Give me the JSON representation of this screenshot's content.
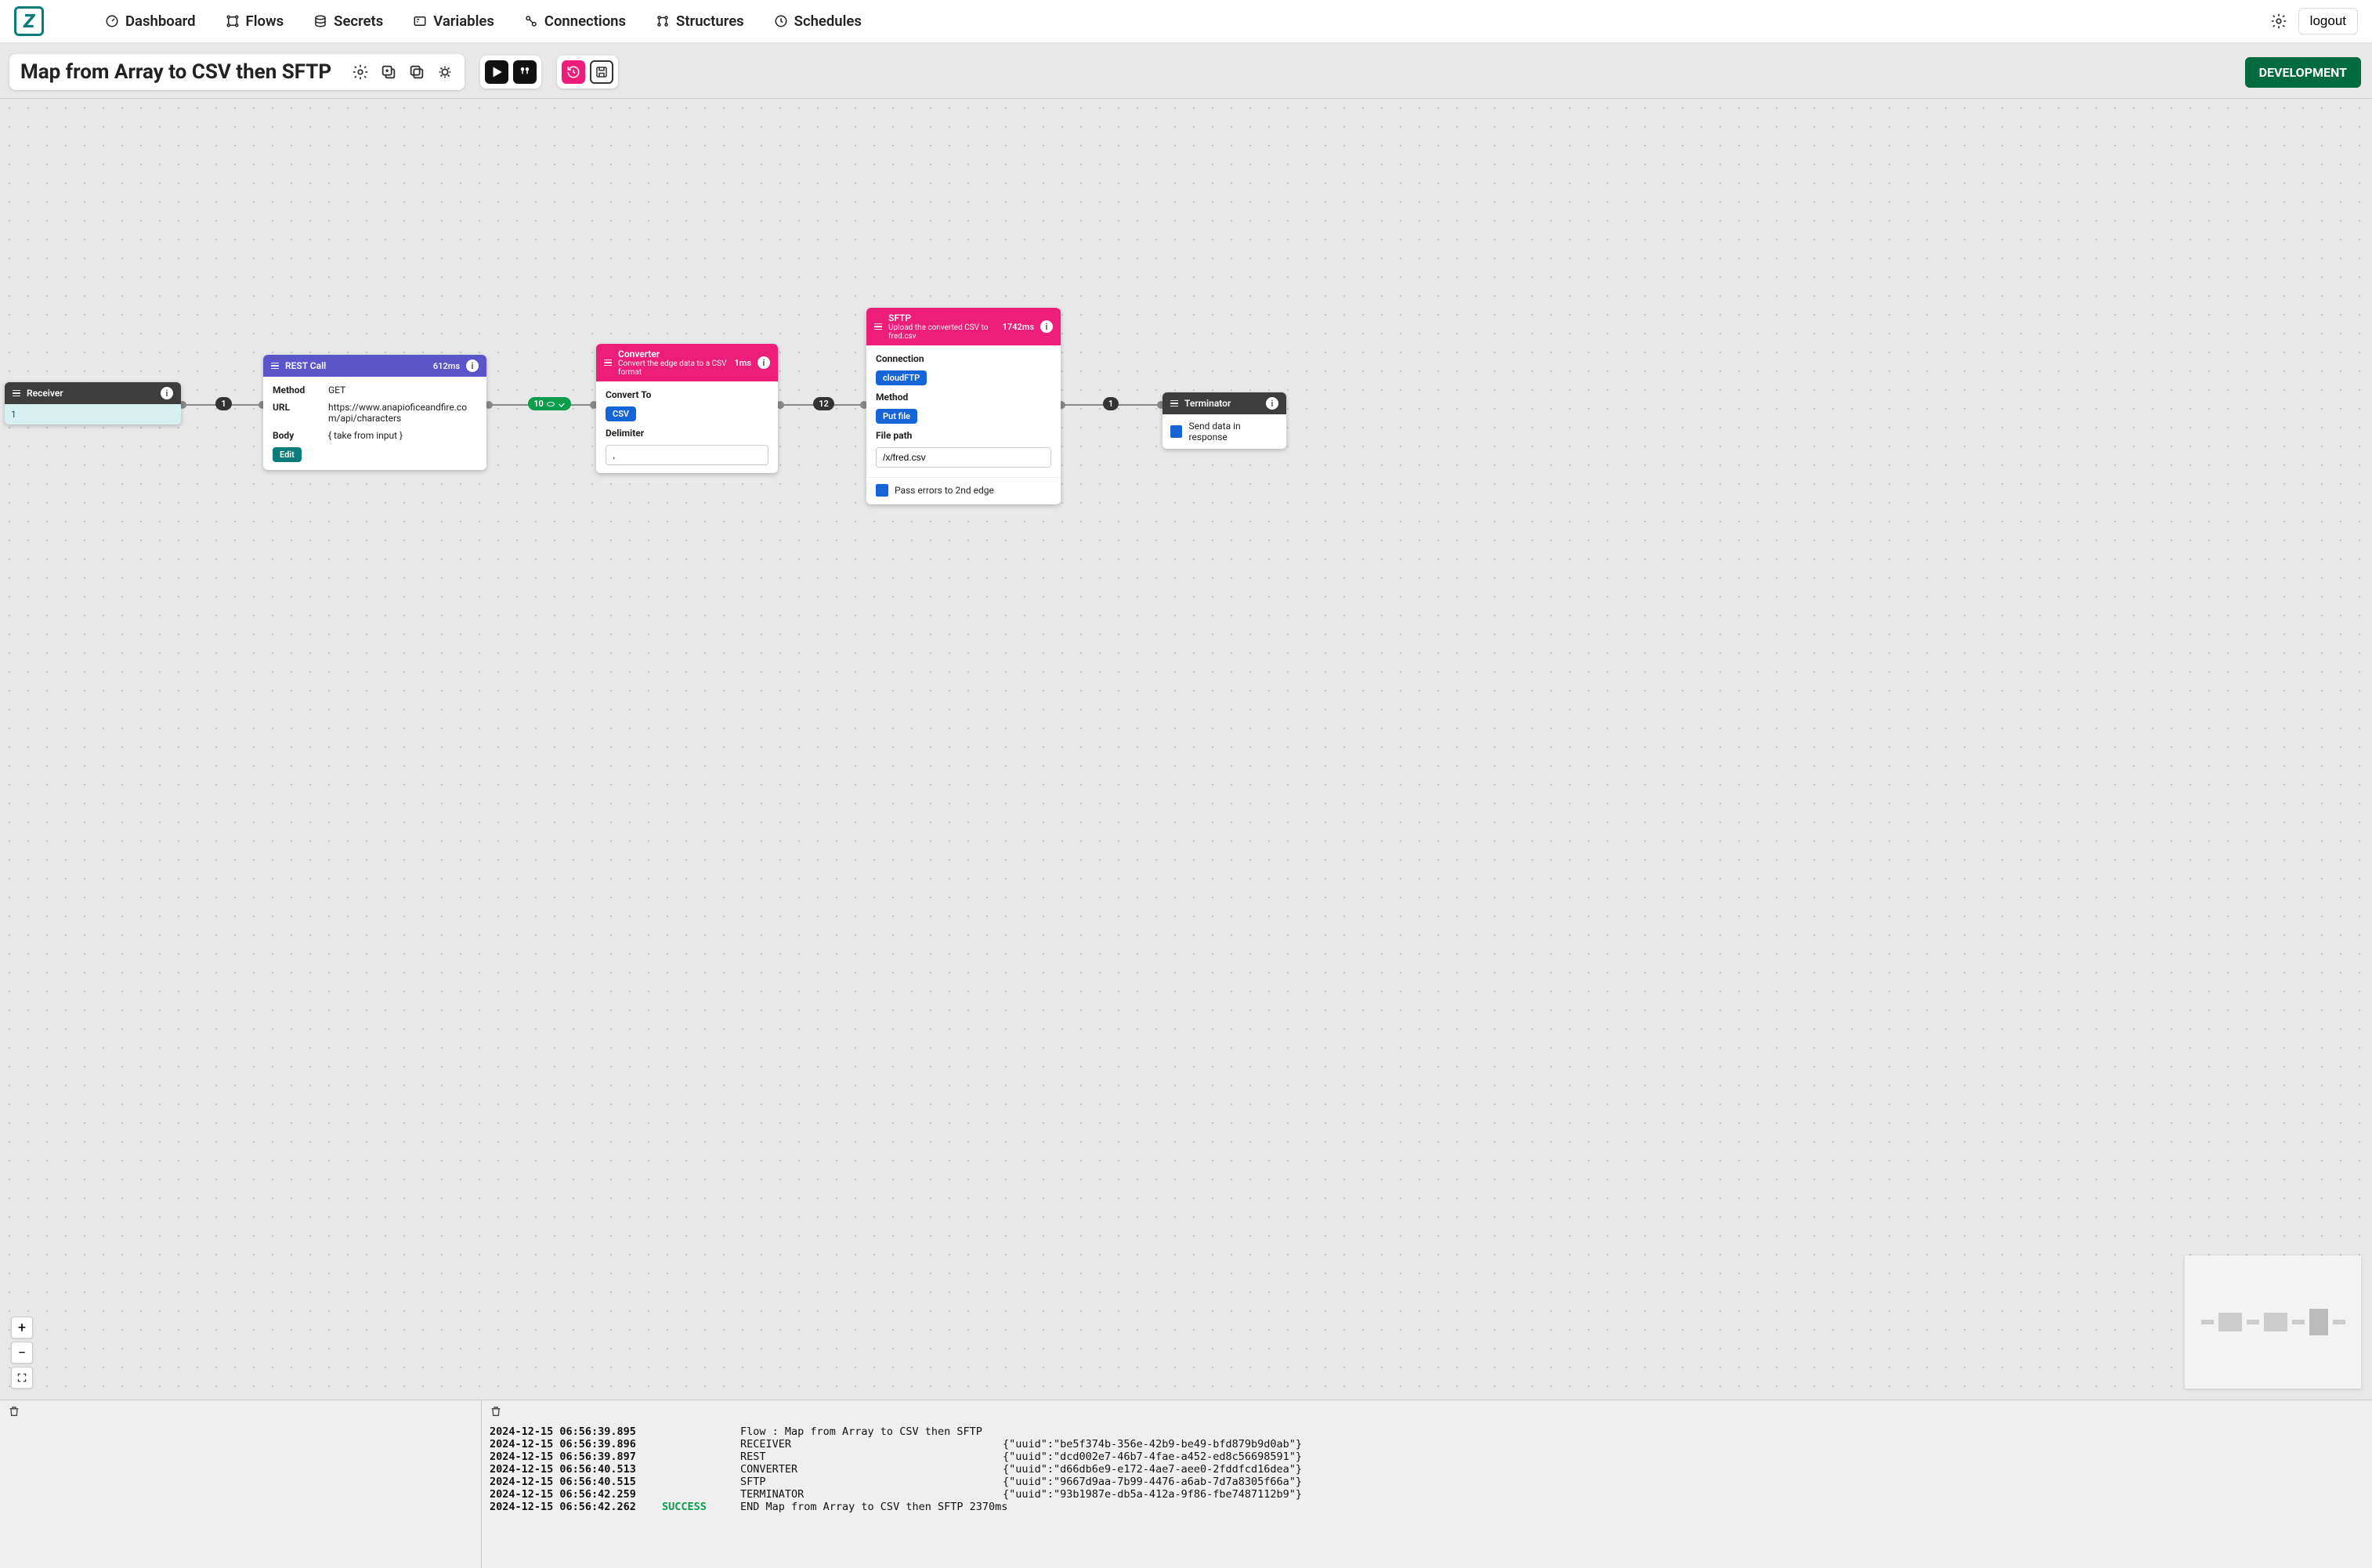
{
  "nav": {
    "items": [
      {
        "label": "Dashboard"
      },
      {
        "label": "Flows"
      },
      {
        "label": "Secrets"
      },
      {
        "label": "Variables"
      },
      {
        "label": "Connections"
      },
      {
        "label": "Structures"
      },
      {
        "label": "Schedules"
      }
    ],
    "logout": "logout"
  },
  "flow": {
    "title": "Map from Array to CSV then SFTP",
    "env": "DEVELOPMENT"
  },
  "edges": {
    "e1": "1",
    "e2": "10",
    "e3": "12",
    "e4": "1"
  },
  "nodes": {
    "receiver": {
      "title": "Receiver",
      "body": "1"
    },
    "rest": {
      "title": "REST Call",
      "timing": "612ms",
      "method_k": "Method",
      "method_v": "GET",
      "url_k": "URL",
      "url_v": "https://www.anapioficeandfire.com/api/characters",
      "body_k": "Body",
      "body_v": "{ take from input }",
      "edit": "Edit"
    },
    "converter": {
      "title": "Converter",
      "subtitle": "Convert the edge data to a CSV format",
      "timing": "1ms",
      "convert_to_k": "Convert To",
      "convert_to_v": "CSV",
      "delim_k": "Delimiter",
      "delim_v": ","
    },
    "sftp": {
      "title": "SFTP",
      "subtitle": "Upload the converted CSV to fred.csv",
      "timing": "1742ms",
      "conn_k": "Connection",
      "conn_v": "cloudFTP",
      "method_k": "Method",
      "method_v": "Put file",
      "path_k": "File path",
      "path_v": "/x/fred.csv",
      "errors": "Pass errors to 2nd edge"
    },
    "terminator": {
      "title": "Terminator",
      "send": "Send data in response"
    }
  },
  "logs": [
    {
      "ts": "2024-12-15 06:56:39.895",
      "status": "",
      "type": "Flow : Map from Array to CSV then SFTP",
      "body": ""
    },
    {
      "ts": "2024-12-15 06:56:39.896",
      "status": "",
      "type": "RECEIVER",
      "body": "{\"uuid\":\"be5f374b-356e-42b9-be49-bfd879b9d0ab\"}"
    },
    {
      "ts": "2024-12-15 06:56:39.897",
      "status": "",
      "type": "REST",
      "body": "{\"uuid\":\"dcd002e7-46b7-4fae-a452-ed8c56698591\"}"
    },
    {
      "ts": "2024-12-15 06:56:40.513",
      "status": "",
      "type": "CONVERTER",
      "body": "{\"uuid\":\"d66db6e9-e172-4ae7-aee0-2fddfcd16dea\"}"
    },
    {
      "ts": "2024-12-15 06:56:40.515",
      "status": "",
      "type": "SFTP",
      "body": "{\"uuid\":\"9667d9aa-7b99-4476-a6ab-7d7a8305f66a\"}"
    },
    {
      "ts": "2024-12-15 06:56:42.259",
      "status": "",
      "type": "TERMINATOR",
      "body": "{\"uuid\":\"93b1987e-db5a-412a-9f86-fbe7487112b9\"}"
    },
    {
      "ts": "2024-12-15 06:56:42.262",
      "status": "SUCCESS",
      "type": "END Map from Array to CSV then SFTP 2370ms",
      "body": ""
    }
  ]
}
